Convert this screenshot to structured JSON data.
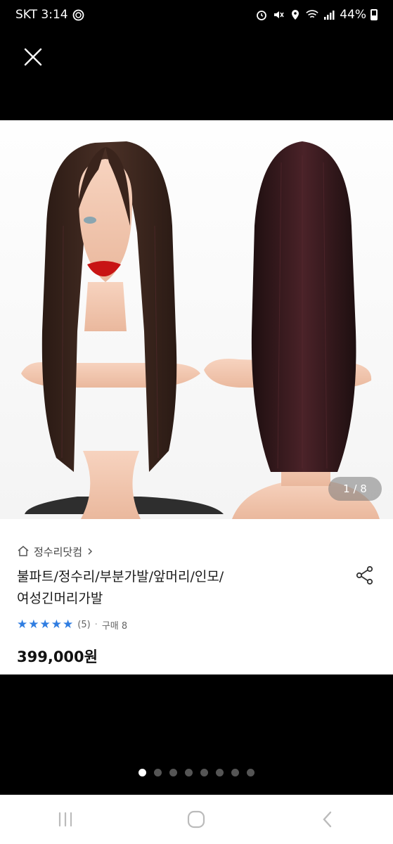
{
  "status_bar": {
    "carrier_time": "SKT 3:14",
    "battery": "44%"
  },
  "product": {
    "image_counter": "1 / 8",
    "store_name": "정수리닷컴",
    "title": "불파트/정수리/부분가발/앞머리/인모/\n여성긴머리가발",
    "rating_count": "(5)",
    "purchase_count": "구매 8",
    "price": "399,000원",
    "rating_stars": 5
  },
  "gallery": {
    "total_pages": 8,
    "active_page": 1
  },
  "colors": {
    "star": "#2f7de1",
    "background": "#000000"
  }
}
